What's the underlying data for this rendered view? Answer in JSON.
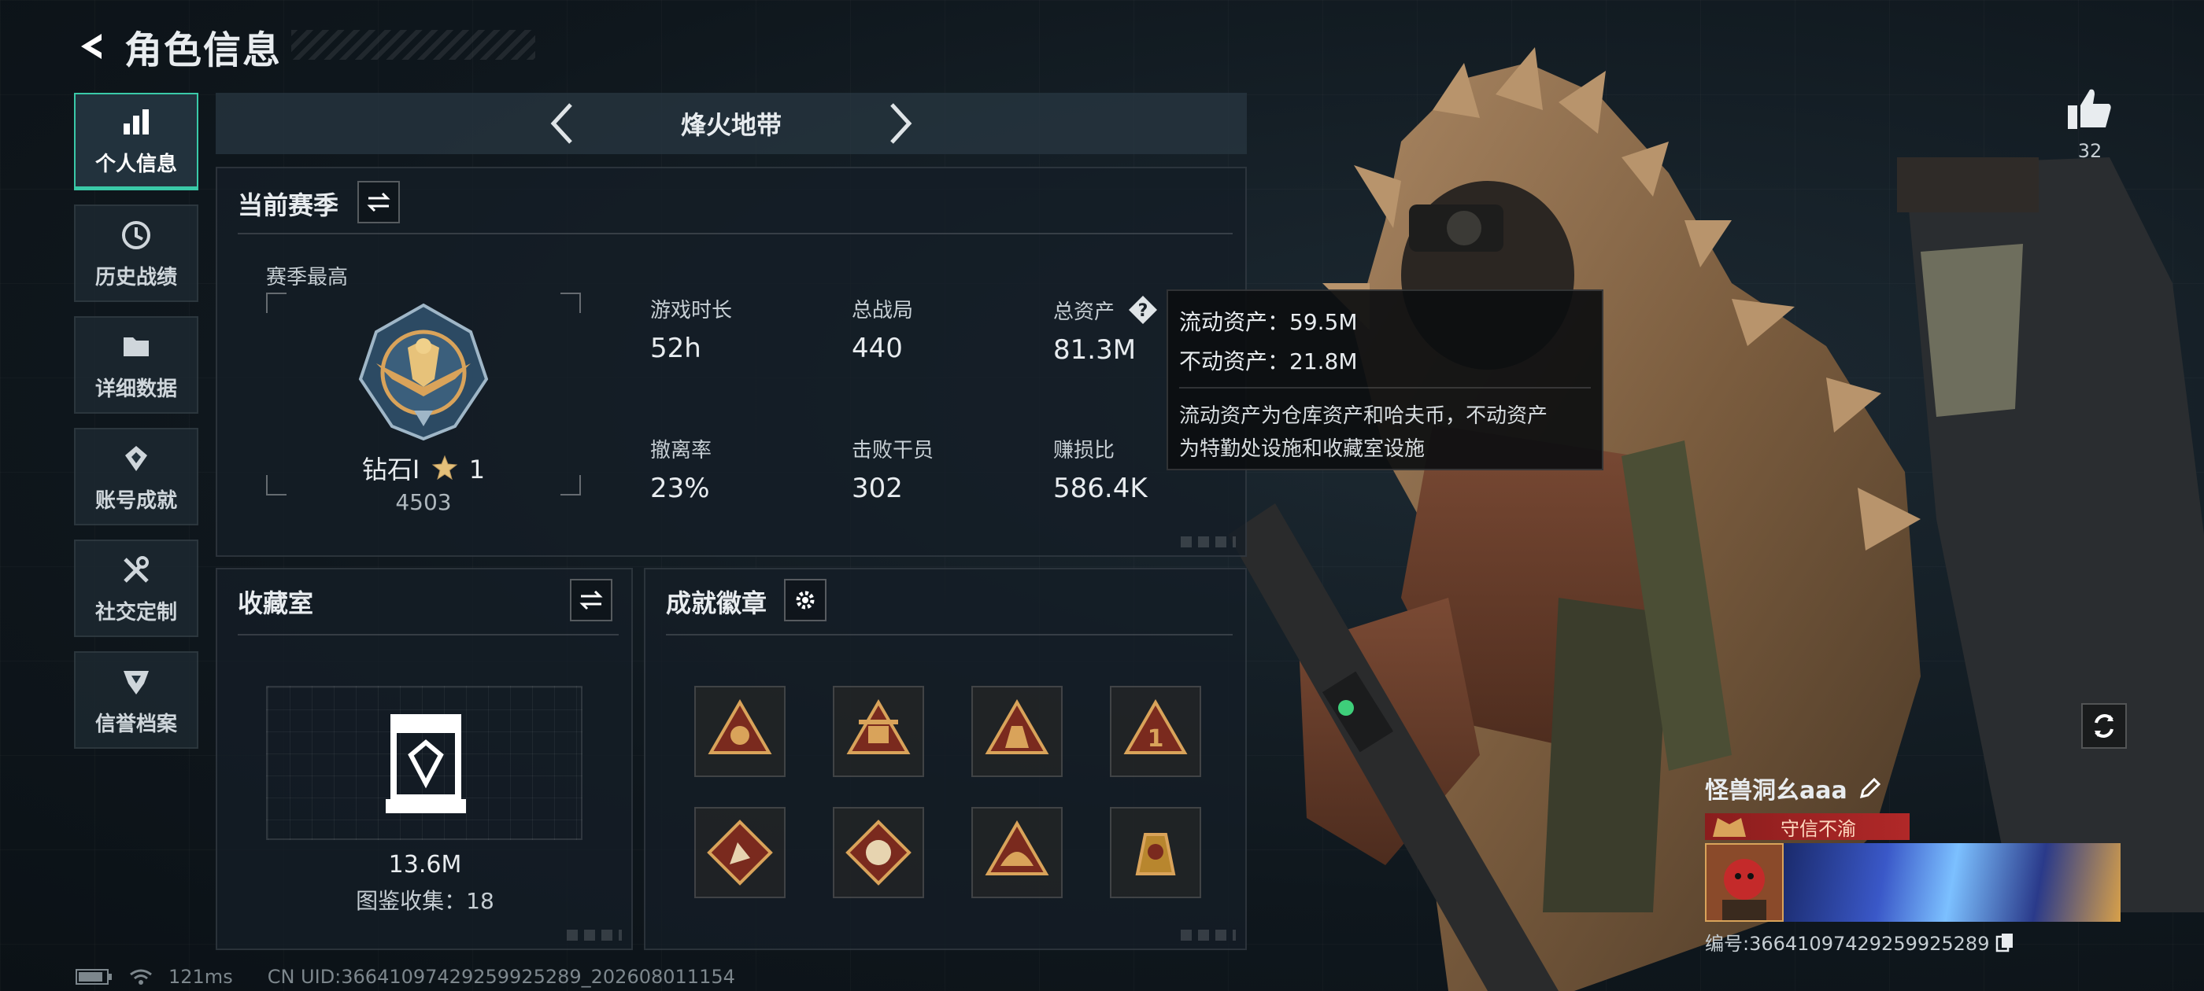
{
  "header": {
    "title": "角色信息"
  },
  "sidebar": {
    "items": [
      {
        "label": "个人信息",
        "icon": "bar-chart-icon",
        "active": true
      },
      {
        "label": "历史战绩",
        "icon": "history-icon"
      },
      {
        "label": "详细数据",
        "icon": "folder-icon"
      },
      {
        "label": "账号成就",
        "icon": "achievement-icon"
      },
      {
        "label": "社交定制",
        "icon": "tools-icon"
      },
      {
        "label": "信誉档案",
        "icon": "shield-icon"
      }
    ]
  },
  "mode": {
    "title": "烽火地带"
  },
  "season": {
    "title": "当前赛季",
    "best_label": "赛季最高",
    "rank_name": "钻石I",
    "rank_star": "1",
    "rank_score": "4503",
    "stats": [
      {
        "label": "游戏时长",
        "value": "52h"
      },
      {
        "label": "总战局",
        "value": "440"
      },
      {
        "label": "总资产",
        "value": "81.3M"
      },
      {
        "label": "撤离率",
        "value": "23%"
      },
      {
        "label": "击败干员",
        "value": "302"
      },
      {
        "label": "赚损比",
        "value": "586.4K"
      }
    ]
  },
  "tooltip": {
    "liquid": "流动资产：59.5M",
    "fixed": "不动资产：21.8M",
    "desc_line1": "流动资产为仓库资产和哈夫币，不动资产",
    "desc_line2": "为特勤处设施和收藏室设施"
  },
  "collection": {
    "title": "收藏室",
    "value": "13.6M",
    "count_text": "图鉴收集：18"
  },
  "achievements": {
    "title": "成就徽章",
    "badges": [
      "badge-1",
      "badge-2",
      "badge-3",
      "badge-4",
      "badge-5",
      "badge-6",
      "badge-7",
      "badge-8"
    ]
  },
  "status": {
    "ping": "121ms",
    "uid": "CN UID:36641097429259925289_202608011154"
  },
  "player": {
    "likes": "32",
    "name": "怪兽洞幺aaa",
    "title": "守信不渝",
    "id_text": "编号:36641097429259925289"
  },
  "colors": {
    "accent": "#3ac9a8",
    "title_red": "#b02828",
    "gold": "#d9a35a"
  }
}
